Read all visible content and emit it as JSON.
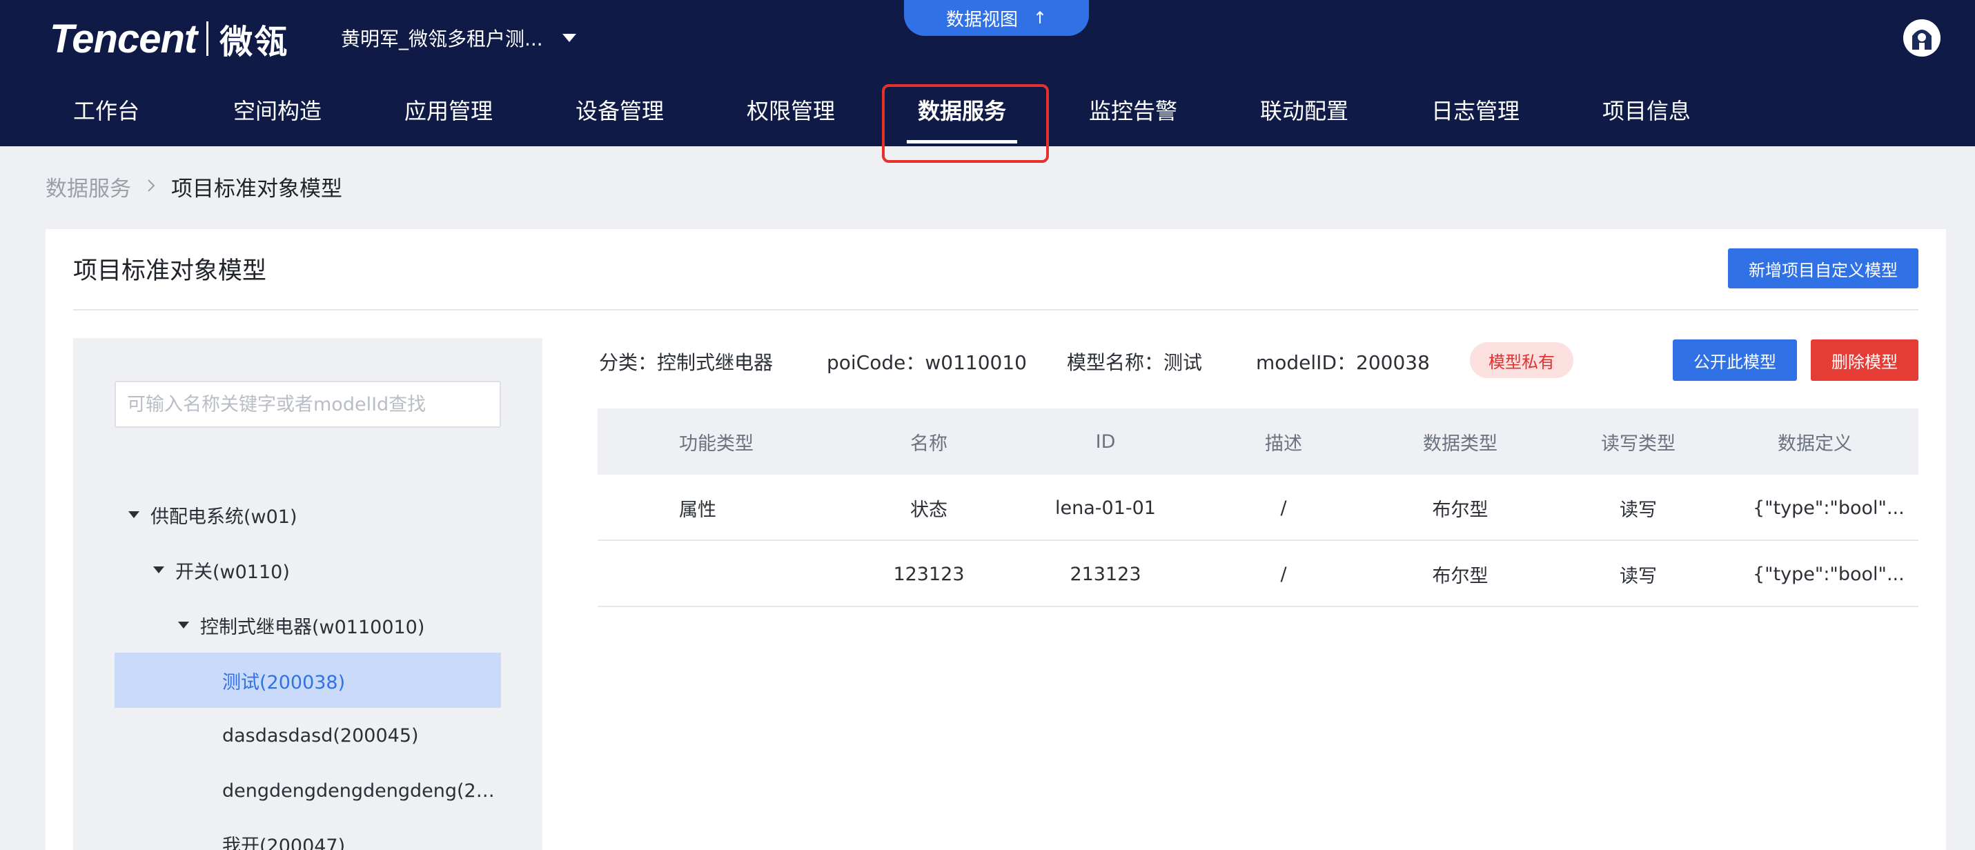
{
  "header": {
    "logo_text": "Tencent",
    "logo_sub": "微瓴",
    "tenant_name": "黄明军_微瓴多租户测...",
    "data_view_label": "数据视图",
    "data_view_arrow": "↑"
  },
  "nav": {
    "items": [
      "工作台",
      "空间构造",
      "应用管理",
      "设备管理",
      "权限管理",
      "数据服务",
      "监控告警",
      "联动配置",
      "日志管理",
      "项目信息"
    ],
    "active": "数据服务"
  },
  "breadcrumb": {
    "parent": "数据服务",
    "separator": ">",
    "current": "项目标准对象模型"
  },
  "panel": {
    "title": "项目标准对象模型",
    "add_button": "新增项目自定义模型"
  },
  "tree": {
    "search_placeholder": "可输入名称关键字或者modelId查找",
    "items": [
      {
        "label": "供配电系统(w01)",
        "level": 0,
        "expanded": true
      },
      {
        "label": "开关(w0110)",
        "level": 1,
        "expanded": true
      },
      {
        "label": "控制式继电器(w0110010)",
        "level": 2,
        "expanded": true
      },
      {
        "label": "测试(200038)",
        "level": 3,
        "selected": true
      },
      {
        "label": "dasdasdasd(200045)",
        "level": 3
      },
      {
        "label": "dengdengdengdengdeng(20...",
        "level": 3
      },
      {
        "label": "我开(200047)",
        "level": 3
      }
    ]
  },
  "model_info": {
    "category": "分类：控制式继电器",
    "poi_code": "poiCode：w0110010",
    "model_name": "模型名称：测试",
    "model_id": "modelID：200038",
    "private_tag": "模型私有",
    "public_button": "公开此模型",
    "delete_button": "删除模型"
  },
  "table": {
    "headers": [
      "功能类型",
      "名称",
      "ID",
      "描述",
      "数据类型",
      "读写类型",
      "数据定义"
    ],
    "rows": [
      [
        "属性",
        "状态",
        "lena-01-01",
        "/",
        "布尔型",
        "读写",
        "{\"type\":\"bool\"..."
      ],
      [
        "",
        "123123",
        "213123",
        "/",
        "布尔型",
        "读写",
        "{\"type\":\"bool\"..."
      ]
    ]
  },
  "colors": {
    "header_bg": "#0f1b46",
    "accent_blue": "#3171e6",
    "danger_red": "#e53d36",
    "highlight_border": "#e5302c",
    "selected_bg": "#c9dbf8"
  }
}
